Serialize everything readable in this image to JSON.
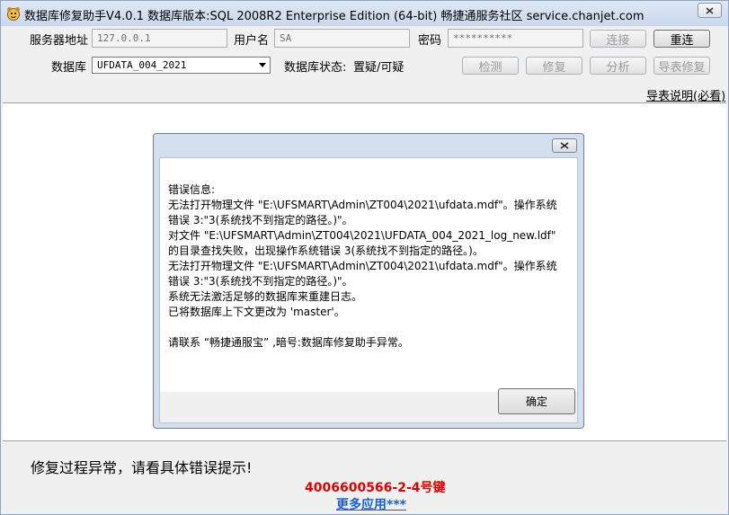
{
  "window": {
    "title": "数据库修复助手V4.0.1 数据库版本:SQL 2008R2 Enterprise Edition (64-bit)   畅捷通服务社区 service.chanjet.com"
  },
  "form": {
    "server_label": "服务器地址",
    "server_value": "127.0.0.1",
    "user_label": "用户名",
    "user_value": "SA",
    "password_label": "密码",
    "password_value": "**********",
    "db_label": "数据库",
    "db_selected": "UFDATA_004_2021",
    "db_status_label": "数据库状态:",
    "db_status_value": "置疑/可疑"
  },
  "buttons": {
    "connect": "连接",
    "reconnect": "重连",
    "check": "检测",
    "repair": "修复",
    "analyze": "分析",
    "import_repair": "导表修复"
  },
  "help_link": "导表说明(必看)",
  "dialog": {
    "lines": [
      "错误信息:",
      "无法打开物理文件 \"E:\\UFSMART\\Admin\\ZT004\\2021\\ufdata.mdf\"。操作系统",
      "错误 3:\"3(系统找不到指定的路径。)\"。",
      "对文件 \"E:\\UFSMART\\Admin\\ZT004\\2021\\UFDATA_004_2021_log_new.ldf\"",
      "的目录查找失败，出现操作系统错误 3(系统找不到指定的路径。)。",
      "无法打开物理文件 \"E:\\UFSMART\\Admin\\ZT004\\2021\\ufdata.mdf\"。操作系统",
      "错误 3:\"3(系统找不到指定的路径。)\"。",
      "系统无法激活足够的数据库来重建日志。",
      "已将数据库上下文更改为 'master'。",
      "请联系 “畅捷通服宝” ,暗号:数据库修复助手异常。"
    ],
    "ok_label": "确定"
  },
  "footer": {
    "status_message": "修复过程异常，请看具体错误提示!",
    "hotline": "4006600566-2-4号键",
    "more_apps": "更多应用***"
  },
  "colors": {
    "hotline": "#e00000",
    "link": "#1a5fd6"
  }
}
